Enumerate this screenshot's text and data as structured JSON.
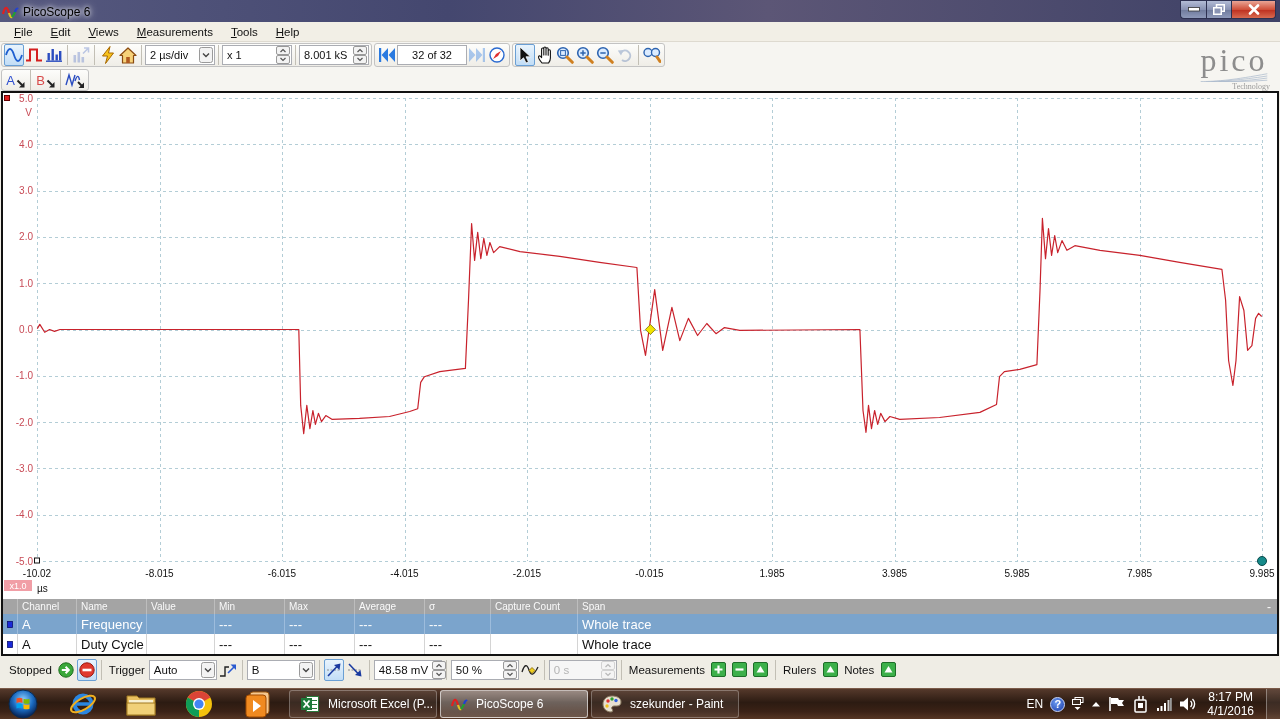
{
  "window": {
    "title": "PicoScope 6"
  },
  "menu": [
    "File",
    "Edit",
    "Views",
    "Measurements",
    "Tools",
    "Help"
  ],
  "toolbar": {
    "sections": [
      {
        "groups": [
          {
            "items": [
              {
                "kind": "sine",
                "selected": true
              },
              {
                "kind": "pulse",
                "selected": false
              },
              {
                "kind": "bars",
                "selected": false
              }
            ]
          },
          {
            "items": [
              {
                "kind": "export",
                "disabled": true
              }
            ]
          },
          {
            "items": [
              {
                "kind": "bolt"
              },
              {
                "kind": "home"
              }
            ]
          },
          {
            "items": [
              {
                "kind": "dropdown",
                "value": "2 µs/div"
              }
            ]
          },
          {
            "items": [
              {
                "kind": "spinner",
                "value": "x 1"
              }
            ]
          },
          {
            "items": [
              {
                "kind": "spinner",
                "value": "8.001 kS"
              }
            ]
          }
        ]
      },
      {
        "groups": [
          {
            "items": [
              {
                "kind": "first",
                "disabled": false
              },
              {
                "kind": "field",
                "value": "32 of 32",
                "disabled": false
              },
              {
                "kind": "next",
                "disabled": true
              },
              {
                "kind": "compass",
                "disabled": false
              }
            ]
          }
        ]
      },
      {
        "groups": [
          {
            "items": [
              {
                "kind": "pointer",
                "selected": true,
                "disabled": false
              },
              {
                "kind": "hand",
                "selected": false,
                "disabled": false
              },
              {
                "kind": "zoombox",
                "selected": false,
                "disabled": false
              },
              {
                "kind": "zoomin",
                "selected": false,
                "disabled": false
              },
              {
                "kind": "zoomout",
                "selected": false,
                "disabled": false
              },
              {
                "kind": "undo",
                "selected": false,
                "disabled": true
              }
            ]
          },
          {
            "items": [
              {
                "kind": "overview"
              }
            ]
          }
        ]
      }
    ]
  },
  "channel_toolbar": [
    {
      "kind": "channel",
      "label": "A",
      "color": "#2f4fd0"
    },
    {
      "kind": "channel",
      "label": "B",
      "color": "#d84a4a"
    },
    {
      "kind": "math"
    }
  ],
  "logo": {
    "name": "pico",
    "tagline": "Technology"
  },
  "scope": {
    "scale_badge": "x1.0",
    "chart_data": {
      "type": "line",
      "grid": true,
      "xlabel": "µs",
      "ylabel": "V",
      "xlim": [
        -10.015,
        9.985
      ],
      "ylim": [
        -5,
        5
      ],
      "xticks": [
        {
          "value": -10.015,
          "label": "-10.02"
        },
        -8.015,
        -6.015,
        -4.015,
        -2.015,
        -0.015,
        1.985,
        3.985,
        5.985,
        7.985,
        9.985
      ],
      "yticks": [
        {
          "value": 5,
          "label": "5.0"
        },
        {
          "value": 4,
          "label": "4.0"
        },
        {
          "value": 3,
          "label": "3.0"
        },
        {
          "value": 2,
          "label": "2.0"
        },
        {
          "value": 1,
          "label": "1.0"
        },
        {
          "value": 0,
          "label": "0.0"
        },
        {
          "value": -1,
          "label": "-1.0"
        },
        {
          "value": -2,
          "label": "-2.0"
        },
        {
          "value": -3,
          "label": "-3.0"
        },
        {
          "value": -4,
          "label": "-4.0"
        },
        {
          "value": -5,
          "label": "-5.0"
        }
      ],
      "x": [
        -10.01,
        -9.97,
        -9.89,
        -9.81,
        -9.73,
        -9.64,
        -5.74,
        -5.71,
        -5.66,
        -5.61,
        -5.56,
        -5.51,
        -5.47,
        -5.42,
        -5.37,
        -5.3,
        -5.2,
        -4.75,
        -4.26,
        -3.93,
        -3.8,
        -3.75,
        -3.69,
        -3.44,
        -3.02,
        -2.97,
        -2.92,
        -2.87,
        -2.82,
        -2.77,
        -2.72,
        -2.67,
        -2.62,
        -2.56,
        -2.46,
        -2.13,
        -1.48,
        -0.83,
        -0.22,
        -0.16,
        -0.08,
        0.07,
        0.2,
        0.35,
        0.48,
        0.62,
        0.77,
        0.92,
        1.07,
        1.21,
        1.46,
        3.42,
        3.47,
        3.52,
        3.56,
        3.61,
        3.66,
        3.71,
        3.76,
        3.83,
        3.91,
        4.07,
        4.72,
        5.38,
        5.65,
        5.7,
        5.78,
        6.03,
        6.31,
        6.36,
        6.4,
        6.45,
        6.5,
        6.55,
        6.6,
        6.65,
        6.72,
        6.8,
        6.93,
        7.34,
        7.99,
        8.64,
        9.33,
        9.39,
        9.44,
        9.51,
        9.56,
        9.62,
        9.69,
        9.75,
        9.82,
        9.88,
        9.93,
        9.98
      ],
      "series": [
        {
          "color": "#c8222c",
          "values": [
            0.02,
            0.11,
            -0.06,
            0.0,
            -0.04,
            0.0,
            0.0,
            -1.64,
            -2.25,
            -1.64,
            -2.14,
            -1.75,
            -2.05,
            -1.81,
            -1.99,
            -1.86,
            -1.94,
            -1.92,
            -1.88,
            -1.77,
            -1.71,
            -1.14,
            -1.02,
            -0.91,
            -0.84,
            0.63,
            2.29,
            1.49,
            2.1,
            1.53,
            1.97,
            1.6,
            1.88,
            1.66,
            1.79,
            1.68,
            1.58,
            1.45,
            1.34,
            -0.02,
            -0.56,
            0.86,
            -0.45,
            0.48,
            -0.24,
            0.24,
            -0.13,
            0.13,
            -0.09,
            0.04,
            -0.02,
            0.0,
            -1.75,
            -2.22,
            -1.64,
            -2.14,
            -1.75,
            -2.05,
            -1.81,
            -1.99,
            -1.88,
            -1.94,
            -1.9,
            -1.79,
            -1.62,
            -1.02,
            -0.91,
            -0.86,
            -0.76,
            0.84,
            2.4,
            1.53,
            2.18,
            1.6,
            2.03,
            1.66,
            1.92,
            1.71,
            1.81,
            1.71,
            1.6,
            1.45,
            1.3,
            0.63,
            -0.67,
            -1.21,
            -0.67,
            0.71,
            0.41,
            -0.45,
            -0.35,
            0.24,
            0.35,
            0.28
          ]
        }
      ]
    }
  },
  "measurements": {
    "columns": [
      "Channel",
      "Name",
      "Value",
      "Min",
      "Max",
      "Average",
      "σ",
      "Capture Count",
      "Span"
    ],
    "collapse": "-",
    "rows": [
      {
        "selected": true,
        "channel": "A",
        "name": "Frequency",
        "min": "---",
        "max": "---",
        "average": "---",
        "sigma": "---",
        "span": "Whole trace"
      },
      {
        "selected": false,
        "channel": "A",
        "name": "Duty Cycle",
        "min": "---",
        "max": "---",
        "average": "---",
        "sigma": "---",
        "span": "Whole trace"
      }
    ]
  },
  "status_bar": {
    "sections": [
      {
        "groups": [
          {
            "label": "Stopped",
            "items": [
              {
                "kind": "run",
                "selected": false
              },
              {
                "kind": "stop",
                "selected": true
              }
            ]
          }
        ]
      },
      {
        "groups": [
          {
            "label": "Trigger",
            "items": [
              {
                "kind": "dropdown",
                "value": "Auto"
              },
              {
                "kind": "trigsettings"
              }
            ]
          }
        ]
      },
      {
        "groups": [
          {
            "items": [
              {
                "kind": "dropdown",
                "value": "B"
              }
            ]
          }
        ]
      },
      {
        "groups": [
          {
            "items": [
              {
                "kind": "rising",
                "selected": true
              },
              {
                "kind": "falling",
                "selected": false
              }
            ]
          }
        ]
      },
      {
        "groups": [
          {
            "items": [
              {
                "kind": "spinner",
                "value": "48.58 mV"
              }
            ]
          }
        ]
      },
      {
        "groups": [
          {
            "items": [
              {
                "kind": "spinner",
                "value": "50 %"
              },
              {
                "kind": "pretrigger"
              }
            ]
          }
        ]
      },
      {
        "groups": [
          {
            "items": [
              {
                "kind": "spinner",
                "value": "0 s",
                "disabled": true
              }
            ]
          }
        ]
      },
      {
        "groups": [
          {
            "label": "Measurements",
            "items": [
              {
                "kind": "add"
              },
              {
                "kind": "remove"
              },
              {
                "kind": "up"
              }
            ]
          }
        ]
      },
      {
        "groups": [
          {
            "label": "Rulers",
            "items": [
              {
                "kind": "up"
              }
            ]
          },
          {
            "label": "Notes",
            "items": [
              {
                "kind": "up"
              }
            ]
          }
        ]
      }
    ]
  },
  "taskbar": {
    "tasks": [
      {
        "kind": "spreadsheet",
        "label": "Microsoft Excel (P...",
        "selected": false
      },
      {
        "kind": "scope",
        "label": "PicoScope 6",
        "selected": true
      },
      {
        "kind": "paint",
        "label": "szekunder - Paint",
        "selected": false
      }
    ],
    "language": "EN",
    "help": "?",
    "time": "8:17 PM",
    "date": "4/1/2016"
  }
}
